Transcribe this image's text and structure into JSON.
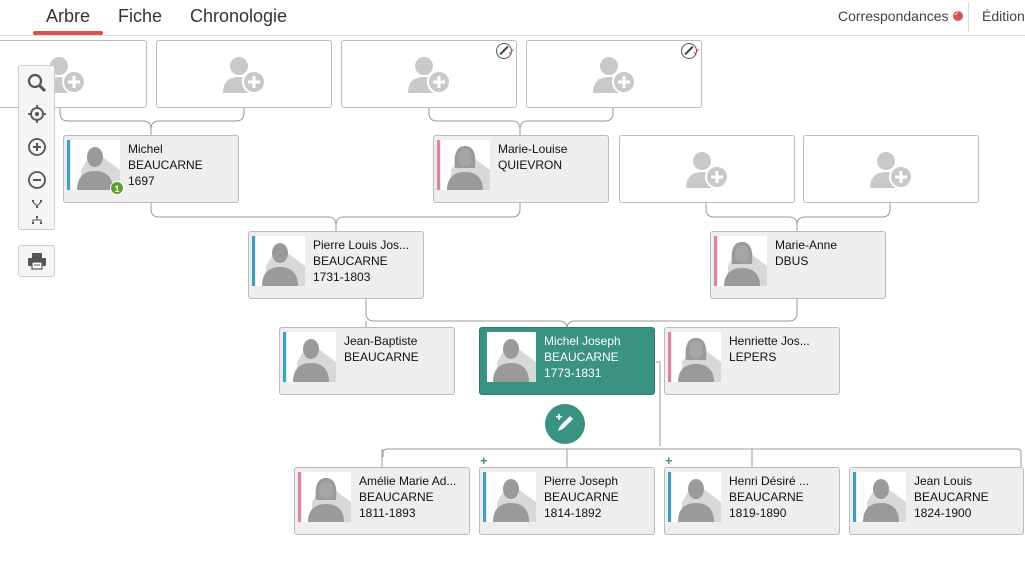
{
  "tabs": [
    {
      "label": "Arbre",
      "active": true
    },
    {
      "label": "Fiche",
      "active": false
    },
    {
      "label": "Chronologie",
      "active": false
    }
  ],
  "header": {
    "correspondances_label": "Correspondances",
    "edition_label": "Édition"
  },
  "toolbar": {
    "icons": [
      "search-icon",
      "locate-icon",
      "zoom-in-icon",
      "zoom-out-icon",
      "collapse-tree-icon",
      "expand-tree-icon",
      "print-icon"
    ]
  },
  "colors": {
    "accent": "#3a9281",
    "male": "#3aa0c4",
    "female": "#e47f9e",
    "tab_underline": "#d9534f"
  },
  "persons": {
    "michel": {
      "first": "Michel",
      "last": "BEAUCARNE",
      "dates": "1697",
      "badge": "1"
    },
    "marie_louise": {
      "first": "Marie-Louise",
      "last": "QUIEVRON",
      "dates": ""
    },
    "pierre_louis": {
      "first": "Pierre Louis Jos...",
      "last": "BEAUCARNE",
      "dates": "1731-1803"
    },
    "marie_anne": {
      "first": "Marie-Anne",
      "last": "DBUS",
      "dates": ""
    },
    "jean_baptiste": {
      "first": "Jean-Baptiste",
      "last": "BEAUCARNE",
      "dates": ""
    },
    "michel_joseph": {
      "first": "Michel Joseph",
      "last": "BEAUCARNE",
      "dates": "1773-1831"
    },
    "henriette": {
      "first": "Henriette Jos...",
      "last": "LEPERS",
      "dates": ""
    },
    "amelie": {
      "first": "Amélie Marie Ad...",
      "last": "BEAUCARNE",
      "dates": "1811-1893"
    },
    "pierre_joseph": {
      "first": "Pierre Joseph",
      "last": "BEAUCARNE",
      "dates": "1814-1892"
    },
    "henri_desire": {
      "first": "Henri Désiré ...",
      "last": "BEAUCARNE",
      "dates": "1819-1890"
    },
    "jean_louis": {
      "first": "Jean Louis",
      "last": "BEAUCARNE",
      "dates": "1824-1900"
    }
  }
}
